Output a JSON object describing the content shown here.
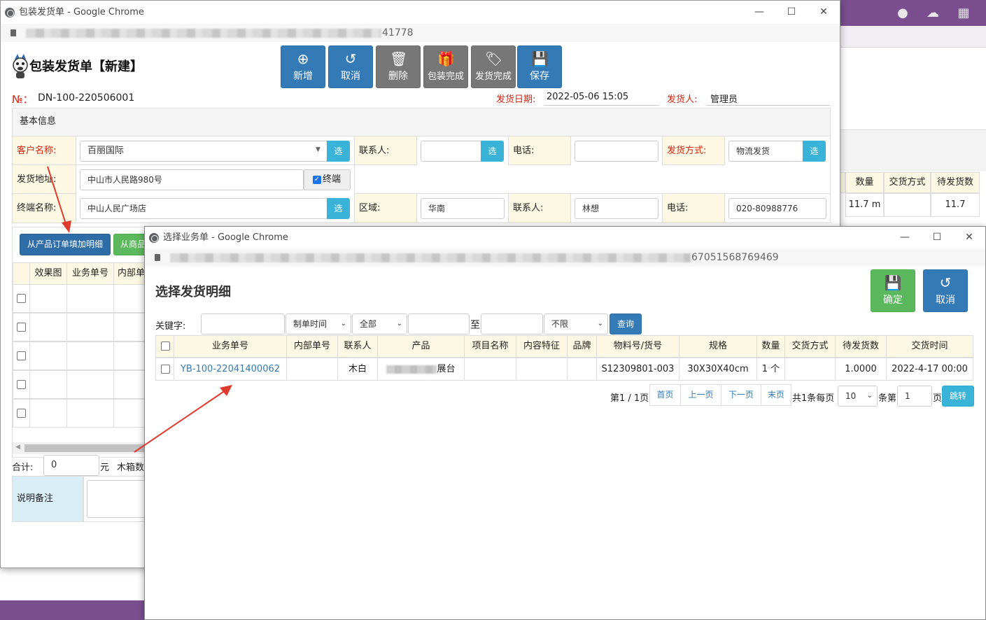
{
  "background": {
    "table_headers": [
      "数量",
      "交货方式",
      "待发货数"
    ],
    "row": {
      "qty": "11.7 m",
      "pending": "11.7"
    }
  },
  "main_window": {
    "title": "包装发货单 - Google Chrome",
    "url_tail": "41778",
    "page_title": "包装发货单【新建】",
    "toolbar": [
      {
        "label": "新增",
        "icon": "plus-circle-icon"
      },
      {
        "label": "取消",
        "icon": "undo-icon"
      },
      {
        "label": "删除",
        "icon": "trash-icon"
      },
      {
        "label": "包装完成",
        "icon": "gift-icon"
      },
      {
        "label": "发货完成",
        "icon": "tag-icon"
      },
      {
        "label": "保存",
        "icon": "save-icon"
      }
    ],
    "no_label": "№：",
    "no_value": "DN-100-220506001",
    "ship_date_label": "发货日期:",
    "ship_date_value": "2022-05-06 15:05",
    "shipper_label": "发货人:",
    "shipper_value": "管理员",
    "section_basic": "基本信息",
    "form": {
      "customer_label": "客户名称:",
      "customer_value": "百丽国际",
      "select_btn": "选",
      "contact_label": "联系人:",
      "contact_value": "",
      "phone_label": "电话:",
      "phone_value": "",
      "ship_method_label": "发货方式:",
      "ship_method_value": "物流发货",
      "address_label": "发货地址:",
      "address_value": "中山市人民路980号",
      "terminal_check": "终端",
      "terminal_label": "终端名称:",
      "terminal_value": "中山人民广场店",
      "region_label": "区域:",
      "region_value": "华南",
      "contact2_label": "联系人:",
      "contact2_value": "林想",
      "phone2_label": "电话:",
      "phone2_value": "020-80988776"
    },
    "btn_add_from_order": "从产品订单填加明细",
    "btn_add_from_product": "从商品",
    "grid_headers": [
      "效果图",
      "业务单号",
      "内部单"
    ],
    "total_label": "合计:",
    "total_value": "0",
    "total_unit": "元",
    "box_label": "木箱数",
    "remark_label": "说明备注"
  },
  "dialog": {
    "title": "选择业务单 - Google Chrome",
    "url_tail": "67051568769469",
    "heading": "选择发货明细",
    "confirm_label": "确定",
    "cancel_label": "取消",
    "keyword_label": "关键字:",
    "keyword_value": "",
    "time_select": "制单时间",
    "all_select": "全部",
    "date_from": "",
    "to_label": "至",
    "date_to": "",
    "limit_select": "不限",
    "query_label": "查询",
    "columns": [
      "业务单号",
      "内部单号",
      "联系人",
      "产品",
      "项目名称",
      "内容特征",
      "品牌",
      "物料号/货号",
      "规格",
      "数量",
      "交货方式",
      "待发货数",
      "交货时间"
    ],
    "rows": [
      {
        "order_no": "YB-100-22041400062",
        "internal_no": "",
        "contact": "木白",
        "product": "展台",
        "project": "",
        "feature": "",
        "brand": "",
        "material_no": "S12309801-003",
        "spec": "30X30X40cm",
        "qty": "1 个",
        "delivery_method": "",
        "pending": "1.0000",
        "delivery_time": "2022-4-17 00:00"
      }
    ],
    "pager": {
      "page_info": "第1 / 1页",
      "first": "首页",
      "prev": "上一页",
      "next": "下一页",
      "last": "末页",
      "total_text": "共1条每页",
      "page_size": "10",
      "per_text": "条第",
      "page_input": "1",
      "page_unit": "页",
      "jump": "跳转"
    }
  }
}
